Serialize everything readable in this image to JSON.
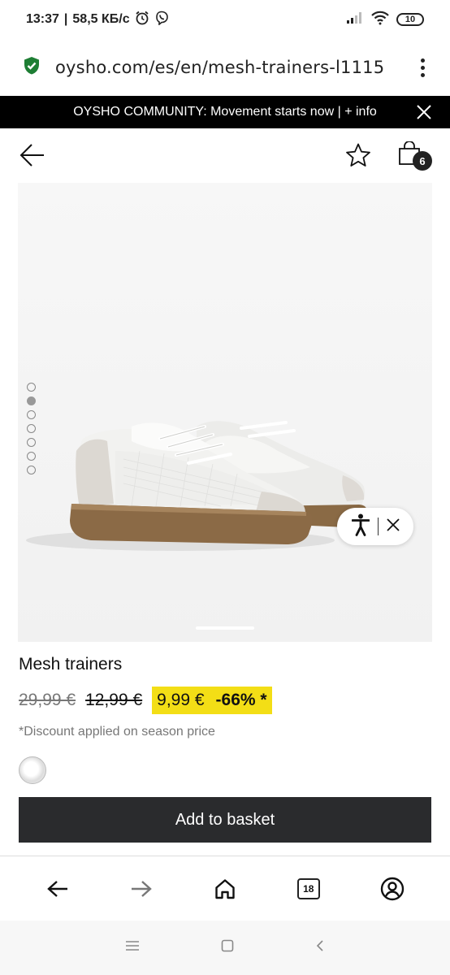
{
  "status_bar": {
    "time": "13:37",
    "network_speed": "58,5 КБ/с",
    "battery": "10"
  },
  "url_bar": {
    "url": "oysho.com/es/en/mesh-trainers-l1115"
  },
  "promo": {
    "text": "OYSHO COMMUNITY: Movement starts now | + info"
  },
  "header": {
    "bag_count": "6"
  },
  "product": {
    "name": "Mesh trainers",
    "price_original": "29,99 €",
    "price_previous": "12,99 €",
    "price_sale": "9,99 €",
    "discount": "-66% *",
    "discount_note": "*Discount applied on season price",
    "image_count": 7,
    "active_image_index": 2,
    "add_to_basket_label": "Add to basket"
  },
  "browser_nav": {
    "tab_count": "18"
  },
  "colors": {
    "promo_background": "#000000",
    "sale_highlight": "#f3de16",
    "basket_button": "#2a2b2d",
    "secure_green": "#1e7e34"
  },
  "icons": {
    "status": [
      "alarm-icon",
      "viber-icon",
      "signal-icon",
      "wifi-icon",
      "battery-icon"
    ],
    "header": [
      "back-arrow-icon",
      "star-icon",
      "shopping-bag-icon"
    ],
    "browser_nav": [
      "back-icon",
      "forward-icon",
      "home-icon",
      "tabs-icon",
      "profile-icon"
    ],
    "system_nav": [
      "menu-lines-icon",
      "square-icon",
      "chevron-left-icon"
    ]
  }
}
